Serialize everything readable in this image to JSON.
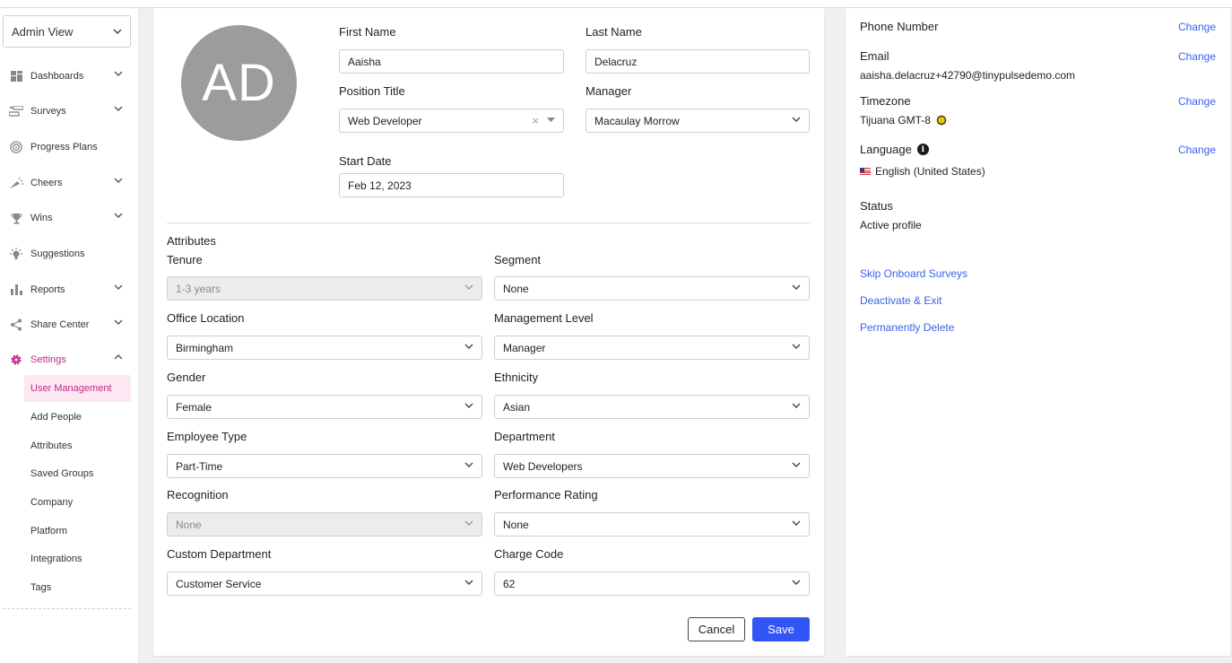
{
  "sidebar": {
    "view_select": "Admin View",
    "nav": [
      {
        "label": "Dashboards",
        "icon": "grid-icon"
      },
      {
        "label": "Surveys",
        "icon": "survey-icon"
      },
      {
        "label": "Progress Plans",
        "icon": "target-icon"
      },
      {
        "label": "Cheers",
        "icon": "megaphone-icon"
      },
      {
        "label": "Wins",
        "icon": "trophy-icon"
      },
      {
        "label": "Suggestions",
        "icon": "lightbulb-icon"
      },
      {
        "label": "Reports",
        "icon": "bar-chart-icon"
      },
      {
        "label": "Share Center",
        "icon": "share-icon"
      },
      {
        "label": "Settings",
        "icon": "gear-icon"
      }
    ],
    "settings_sub": [
      "User Management",
      "Add People",
      "Attributes",
      "Saved Groups",
      "Company",
      "Platform",
      "Integrations",
      "Tags"
    ]
  },
  "profile": {
    "avatar_initials": "AD",
    "first_name_label": "First Name",
    "first_name": "Aaisha",
    "last_name_label": "Last Name",
    "last_name": "Delacruz",
    "position_title_label": "Position Title",
    "position_title": "Web Developer",
    "manager_label": "Manager",
    "manager": "Macaulay Morrow",
    "start_date_label": "Start Date",
    "start_date": "Feb 12, 2023"
  },
  "attributes": {
    "heading": "Attributes",
    "fields": [
      {
        "label": "Tenure",
        "value": "1-3 years",
        "disabled": true
      },
      {
        "label": "Segment",
        "value": "None",
        "disabled": false
      },
      {
        "label": "Office Location",
        "value": "Birmingham",
        "disabled": false
      },
      {
        "label": "Management Level",
        "value": "Manager",
        "disabled": false
      },
      {
        "label": "Gender",
        "value": "Female",
        "disabled": false
      },
      {
        "label": "Ethnicity",
        "value": "Asian",
        "disabled": false
      },
      {
        "label": "Employee Type",
        "value": "Part-Time",
        "disabled": false
      },
      {
        "label": "Department",
        "value": "Web Developers",
        "disabled": false
      },
      {
        "label": "Recognition",
        "value": "None",
        "disabled": true
      },
      {
        "label": "Performance Rating",
        "value": "None",
        "disabled": false
      },
      {
        "label": "Custom Department",
        "value": "Customer Service",
        "disabled": false
      },
      {
        "label": "Charge Code",
        "value": "62",
        "disabled": false
      }
    ]
  },
  "actions": {
    "cancel": "Cancel",
    "save": "Save"
  },
  "account": {
    "phone_label": "Phone Number",
    "email_label": "Email",
    "email": "aaisha.delacruz+42790@tinypulsedemo.com",
    "timezone_label": "Timezone",
    "timezone": "Tijuana GMT-8",
    "language_label": "Language",
    "language": "English (United States)",
    "status_label": "Status",
    "status": "Active profile",
    "change_label": "Change",
    "links": {
      "skip_onboard": "Skip Onboard Surveys",
      "deactivate": "Deactivate & Exit",
      "delete": "Permanently Delete"
    }
  },
  "colors": {
    "accent": "#c2288f",
    "primary_button": "#3256f5",
    "link": "#3a62e8"
  }
}
